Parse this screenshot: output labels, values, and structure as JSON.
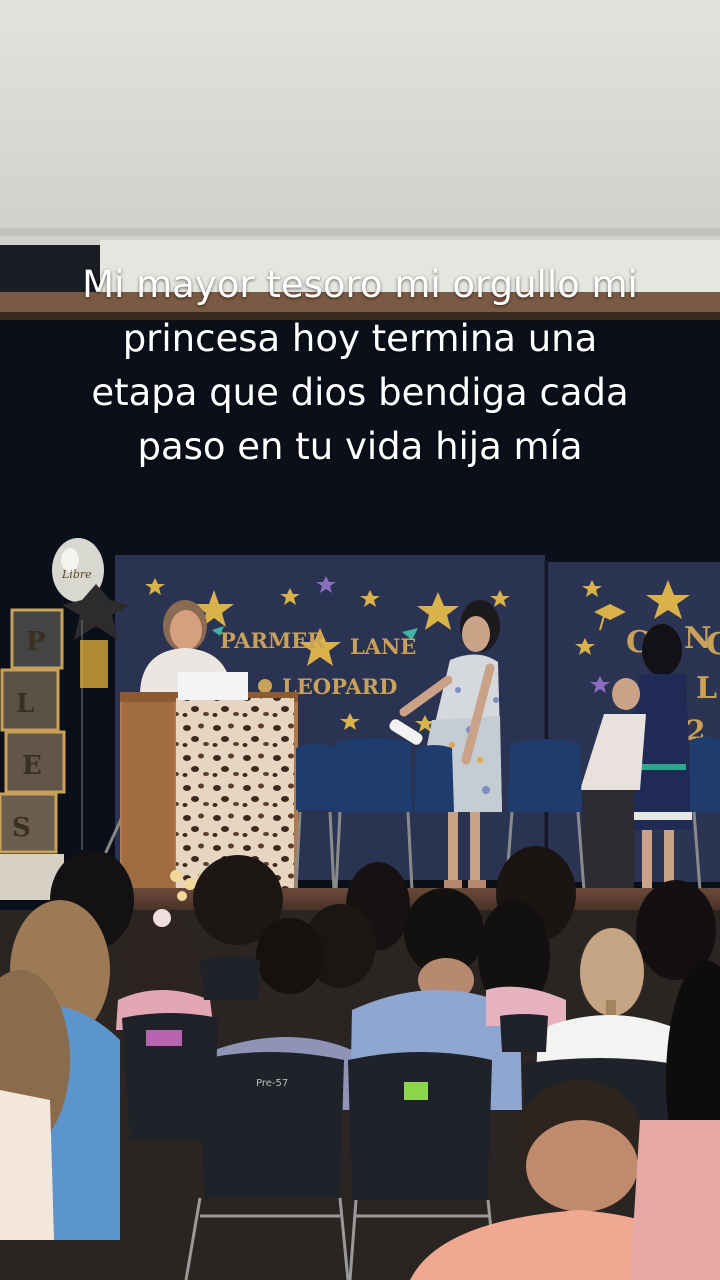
{
  "caption": {
    "lines": [
      "Mi mayor tesoro mi orgullo mi",
      "princesa hoy termina una",
      "etapa que dios bendiga cada",
      "paso en tu vida hija mía"
    ]
  },
  "stage_sign": {
    "word1": "PARMER",
    "word2": "LANE",
    "word3": "LEOPARD",
    "right_panel_partial": [
      "C",
      "N",
      "G",
      "L",
      "2"
    ]
  },
  "letter_boxes": [
    "P",
    "L",
    "E",
    "S"
  ],
  "balloon_text": "Libre",
  "seat_tag": "Pre-57",
  "colors": {
    "backdrop_navy": "#2b3352",
    "curtain": "#0b0f1a",
    "wall": "#dcdcd6",
    "star_gold": "#d9b34a",
    "leopard": "#e8d8c4",
    "chairs": "#1f2228"
  }
}
